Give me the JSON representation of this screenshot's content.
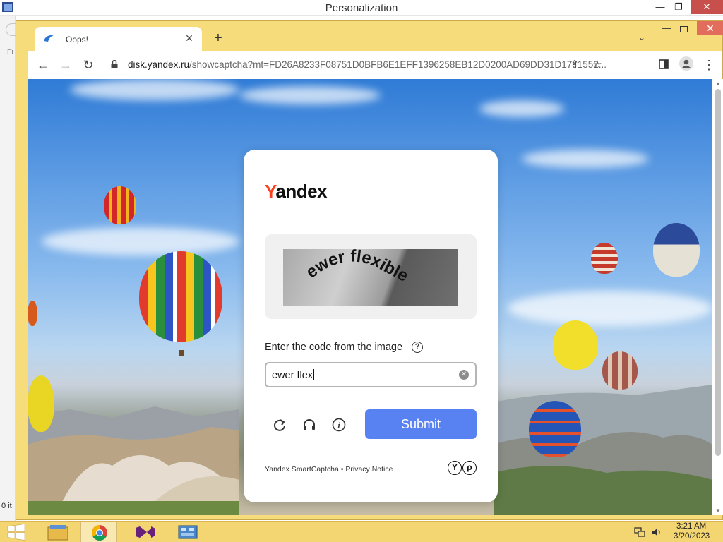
{
  "bg_window": {
    "title": "Personalization",
    "left_text": "Fi",
    "bottom_text": "0 it"
  },
  "browser": {
    "tab": {
      "title": "Oops!"
    },
    "address": {
      "domain": "disk.yandex.ru",
      "path": "/showcaptcha?mt=FD26A8233F08751D0BFB6E1EFF1396258EB12D0200AD69DD31D1741552..."
    }
  },
  "captcha": {
    "logo": {
      "first_letter": "Y",
      "rest": "andex"
    },
    "image_text": "ewer flexible",
    "prompt": "Enter the code from the image",
    "help_glyph": "?",
    "input_value": "ewer flex",
    "submit_label": "Submit",
    "footer": "Yandex SmartCaptcha • Privacy Notice"
  },
  "taskbar": {
    "time": "3:21 AM",
    "date": "3/20/2023"
  },
  "colors": {
    "yandex_red": "#fc3f1d",
    "submit_blue": "#5882f2",
    "frame_yellow": "#f6dc7a"
  },
  "icons": [
    "back-icon",
    "forward-icon",
    "reload-icon",
    "lock-icon",
    "share-icon",
    "star-icon",
    "sidepanel-icon",
    "profile-icon",
    "menu-icon",
    "refresh-icon",
    "audio-icon",
    "info-icon",
    "clear-icon",
    "help-icon",
    "windows-start-icon",
    "file-explorer-icon",
    "chrome-icon",
    "visual-studio-icon",
    "control-panel-icon",
    "network-icon",
    "volume-icon"
  ]
}
